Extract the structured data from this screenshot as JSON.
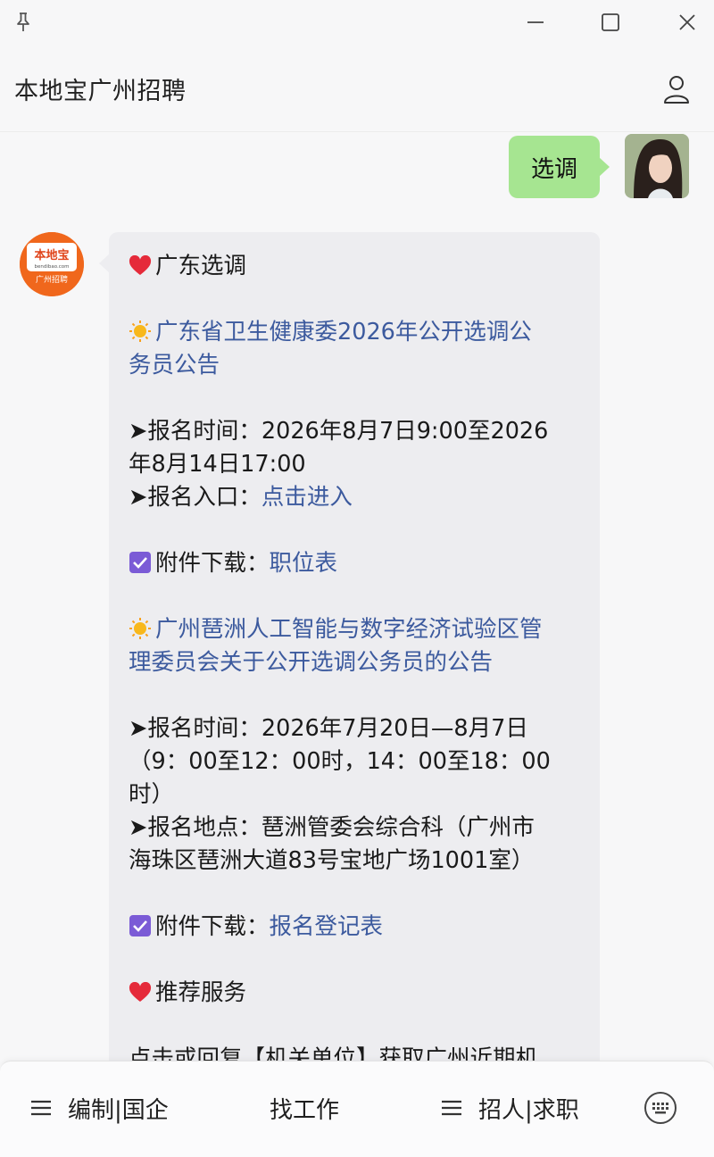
{
  "header": {
    "title": "本地宝广州招聘"
  },
  "chat": {
    "sent": {
      "text": "选调"
    },
    "bot_avatar": {
      "brand": "本地宝",
      "domain": "bendibao.com",
      "tag": "广州招聘"
    },
    "reply": {
      "section1_title": "广东选调",
      "item1_title_l1": "广东省卫生健康委2026年公开选调公",
      "item1_title_l2": "务员公告",
      "item1_time_l1": "➤报名时间：2026年8月7日9:00至2026",
      "item1_time_l2": "年8月14日17:00",
      "item1_entry_label": "➤报名入口：",
      "item1_entry_link": "点击进入",
      "item1_dl_label": "附件下载：",
      "item1_dl_link": "职位表",
      "item2_title_l1": "广州琶洲人工智能与数字经济试验区管",
      "item2_title_l2": "理委员会关于公开选调公务员的公告",
      "item2_time_l1": "➤报名时间：2026年7月20日—8月7日",
      "item2_time_l2": "（9：00至12：00时，14：00至18：00",
      "item2_time_l3": "时）",
      "item2_place_l1": "➤报名地点：琶洲管委会综合科（广州市",
      "item2_place_l2": "海珠区琶洲大道83号宝地广场1001室）",
      "item2_dl_label": "附件下载：",
      "item2_dl_link": "报名登记表",
      "section2_title": "推荐服务",
      "section2_cut": "点击或回复【机关单位】获取广州近期机"
    }
  },
  "bottom_menu": {
    "btn1": "编制|国企",
    "btn2": "找工作",
    "btn3": "招人|求职"
  },
  "colors": {
    "sent_bubble": "#a6e591",
    "received_bubble": "#ededf0",
    "link": "#3c5a9e",
    "brand_orange": "#f0671c"
  },
  "icons": [
    "pin-icon",
    "minimize-icon",
    "maximize-icon",
    "close-icon",
    "profile-icon",
    "heart-icon",
    "sun-icon",
    "checkbox-icon",
    "hamburger-icon",
    "keyboard-icon"
  ]
}
